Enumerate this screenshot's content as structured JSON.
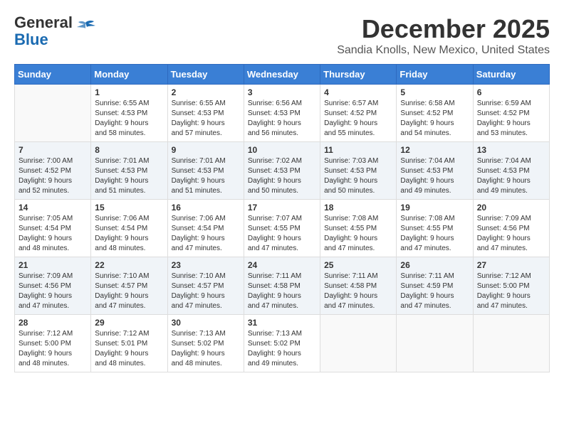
{
  "header": {
    "logo_general": "General",
    "logo_blue": "Blue",
    "month": "December 2025",
    "location": "Sandia Knolls, New Mexico, United States"
  },
  "days_of_week": [
    "Sunday",
    "Monday",
    "Tuesday",
    "Wednesday",
    "Thursday",
    "Friday",
    "Saturday"
  ],
  "weeks": [
    [
      {
        "day": "",
        "info": ""
      },
      {
        "day": "1",
        "info": "Sunrise: 6:55 AM\nSunset: 4:53 PM\nDaylight: 9 hours\nand 58 minutes."
      },
      {
        "day": "2",
        "info": "Sunrise: 6:55 AM\nSunset: 4:53 PM\nDaylight: 9 hours\nand 57 minutes."
      },
      {
        "day": "3",
        "info": "Sunrise: 6:56 AM\nSunset: 4:53 PM\nDaylight: 9 hours\nand 56 minutes."
      },
      {
        "day": "4",
        "info": "Sunrise: 6:57 AM\nSunset: 4:52 PM\nDaylight: 9 hours\nand 55 minutes."
      },
      {
        "day": "5",
        "info": "Sunrise: 6:58 AM\nSunset: 4:52 PM\nDaylight: 9 hours\nand 54 minutes."
      },
      {
        "day": "6",
        "info": "Sunrise: 6:59 AM\nSunset: 4:52 PM\nDaylight: 9 hours\nand 53 minutes."
      }
    ],
    [
      {
        "day": "7",
        "info": "Sunrise: 7:00 AM\nSunset: 4:52 PM\nDaylight: 9 hours\nand 52 minutes."
      },
      {
        "day": "8",
        "info": "Sunrise: 7:01 AM\nSunset: 4:53 PM\nDaylight: 9 hours\nand 51 minutes."
      },
      {
        "day": "9",
        "info": "Sunrise: 7:01 AM\nSunset: 4:53 PM\nDaylight: 9 hours\nand 51 minutes."
      },
      {
        "day": "10",
        "info": "Sunrise: 7:02 AM\nSunset: 4:53 PM\nDaylight: 9 hours\nand 50 minutes."
      },
      {
        "day": "11",
        "info": "Sunrise: 7:03 AM\nSunset: 4:53 PM\nDaylight: 9 hours\nand 50 minutes."
      },
      {
        "day": "12",
        "info": "Sunrise: 7:04 AM\nSunset: 4:53 PM\nDaylight: 9 hours\nand 49 minutes."
      },
      {
        "day": "13",
        "info": "Sunrise: 7:04 AM\nSunset: 4:53 PM\nDaylight: 9 hours\nand 49 minutes."
      }
    ],
    [
      {
        "day": "14",
        "info": "Sunrise: 7:05 AM\nSunset: 4:54 PM\nDaylight: 9 hours\nand 48 minutes."
      },
      {
        "day": "15",
        "info": "Sunrise: 7:06 AM\nSunset: 4:54 PM\nDaylight: 9 hours\nand 48 minutes."
      },
      {
        "day": "16",
        "info": "Sunrise: 7:06 AM\nSunset: 4:54 PM\nDaylight: 9 hours\nand 47 minutes."
      },
      {
        "day": "17",
        "info": "Sunrise: 7:07 AM\nSunset: 4:55 PM\nDaylight: 9 hours\nand 47 minutes."
      },
      {
        "day": "18",
        "info": "Sunrise: 7:08 AM\nSunset: 4:55 PM\nDaylight: 9 hours\nand 47 minutes."
      },
      {
        "day": "19",
        "info": "Sunrise: 7:08 AM\nSunset: 4:55 PM\nDaylight: 9 hours\nand 47 minutes."
      },
      {
        "day": "20",
        "info": "Sunrise: 7:09 AM\nSunset: 4:56 PM\nDaylight: 9 hours\nand 47 minutes."
      }
    ],
    [
      {
        "day": "21",
        "info": "Sunrise: 7:09 AM\nSunset: 4:56 PM\nDaylight: 9 hours\nand 47 minutes."
      },
      {
        "day": "22",
        "info": "Sunrise: 7:10 AM\nSunset: 4:57 PM\nDaylight: 9 hours\nand 47 minutes."
      },
      {
        "day": "23",
        "info": "Sunrise: 7:10 AM\nSunset: 4:57 PM\nDaylight: 9 hours\nand 47 minutes."
      },
      {
        "day": "24",
        "info": "Sunrise: 7:11 AM\nSunset: 4:58 PM\nDaylight: 9 hours\nand 47 minutes."
      },
      {
        "day": "25",
        "info": "Sunrise: 7:11 AM\nSunset: 4:58 PM\nDaylight: 9 hours\nand 47 minutes."
      },
      {
        "day": "26",
        "info": "Sunrise: 7:11 AM\nSunset: 4:59 PM\nDaylight: 9 hours\nand 47 minutes."
      },
      {
        "day": "27",
        "info": "Sunrise: 7:12 AM\nSunset: 5:00 PM\nDaylight: 9 hours\nand 47 minutes."
      }
    ],
    [
      {
        "day": "28",
        "info": "Sunrise: 7:12 AM\nSunset: 5:00 PM\nDaylight: 9 hours\nand 48 minutes."
      },
      {
        "day": "29",
        "info": "Sunrise: 7:12 AM\nSunset: 5:01 PM\nDaylight: 9 hours\nand 48 minutes."
      },
      {
        "day": "30",
        "info": "Sunrise: 7:13 AM\nSunset: 5:02 PM\nDaylight: 9 hours\nand 48 minutes."
      },
      {
        "day": "31",
        "info": "Sunrise: 7:13 AM\nSunset: 5:02 PM\nDaylight: 9 hours\nand 49 minutes."
      },
      {
        "day": "",
        "info": ""
      },
      {
        "day": "",
        "info": ""
      },
      {
        "day": "",
        "info": ""
      }
    ]
  ]
}
